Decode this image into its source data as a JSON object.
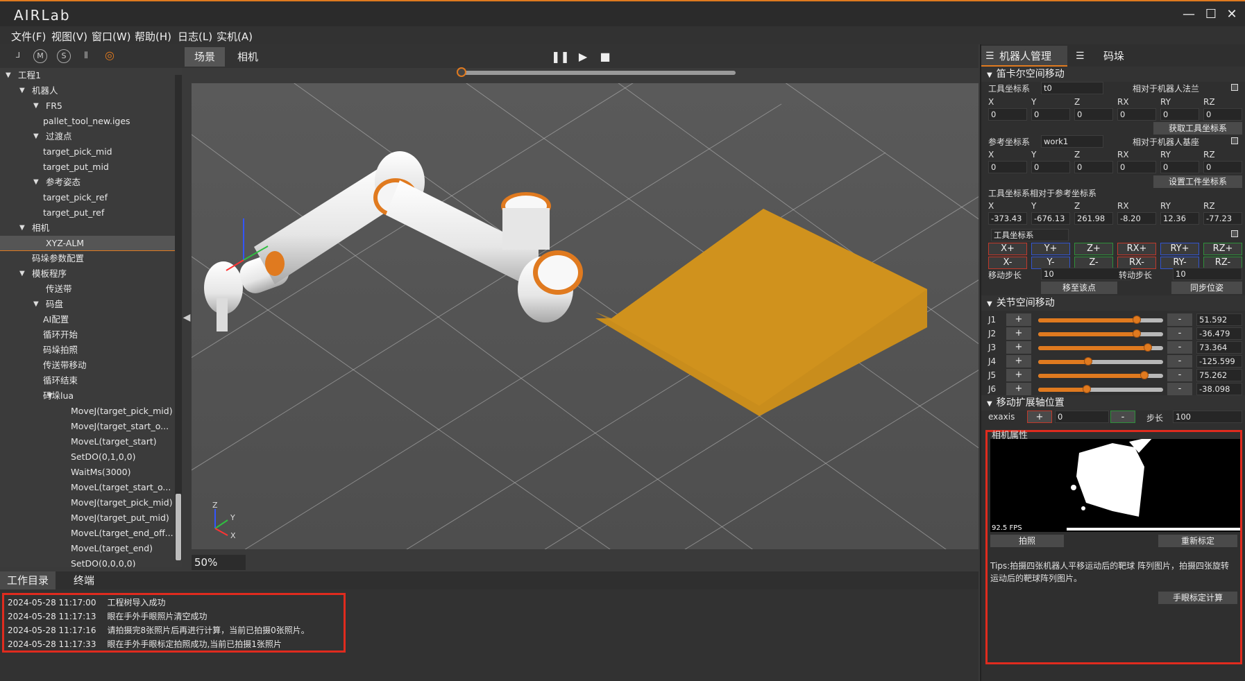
{
  "app": {
    "logo": "AIRLab"
  },
  "window_controls": {
    "minimize": "—",
    "maximize": "☐",
    "close": "✕"
  },
  "menu": [
    "文件(F)",
    "视图(V)",
    "窗口(W)",
    "帮助(H)",
    "日志(L)",
    "实机(A)"
  ],
  "toolbar_icons": [
    "axis-icon",
    "m-icon",
    "s-icon",
    "gripper-icon",
    "target-icon"
  ],
  "toolbar_glyphs": [
    "⅃",
    "M",
    "S",
    "⫼",
    "◎"
  ],
  "viewport_tabs": [
    "场景",
    "相机"
  ],
  "playback": {
    "pause": "❚❚",
    "play": "▶",
    "stop": "■",
    "progress": 0.0
  },
  "tree": [
    {
      "label": "工程1",
      "level": 0,
      "arrow": true
    },
    {
      "label": "机器人",
      "level": 1,
      "arrow": true
    },
    {
      "label": "FR5",
      "level": 2,
      "arrow": true
    },
    {
      "label": "pallet_tool_new.iges",
      "level": 3,
      "arrow": false
    },
    {
      "label": "过渡点",
      "level": 2,
      "arrow": true
    },
    {
      "label": "target_pick_mid",
      "level": 3,
      "arrow": false
    },
    {
      "label": "target_put_mid",
      "level": 3,
      "arrow": false
    },
    {
      "label": "参考姿态",
      "level": 2,
      "arrow": true
    },
    {
      "label": "target_pick_ref",
      "level": 3,
      "arrow": false
    },
    {
      "label": "target_put_ref",
      "level": 3,
      "arrow": false
    },
    {
      "label": "相机",
      "level": 1,
      "arrow": true
    },
    {
      "label": "XYZ-ALM",
      "level": 2,
      "arrow": false,
      "selected": true
    },
    {
      "label": "码垛参数配置",
      "level": 1,
      "arrow": false
    },
    {
      "label": "模板程序",
      "level": 1,
      "arrow": true
    },
    {
      "label": "传送带",
      "level": 2,
      "arrow": false
    },
    {
      "label": "码盘",
      "level": 2,
      "arrow": true
    },
    {
      "label": "AI配置",
      "level": 3,
      "arrow": false
    },
    {
      "label": "循环开始",
      "level": 3,
      "arrow": false
    },
    {
      "label": "码垛拍照",
      "level": 3,
      "arrow": false
    },
    {
      "label": "传送带移动",
      "level": 3,
      "arrow": false
    },
    {
      "label": "循环结束",
      "level": 3,
      "arrow": false
    },
    {
      "label": "码垛lua",
      "level": 3,
      "arrow": true
    },
    {
      "label": "MoveJ(target_pick_mid)",
      "level": 4,
      "arrow": false
    },
    {
      "label": "MoveJ(target_start_o...",
      "level": 4,
      "arrow": false
    },
    {
      "label": "MoveL(target_start)",
      "level": 4,
      "arrow": false
    },
    {
      "label": "SetDO(0,1,0,0)",
      "level": 4,
      "arrow": false
    },
    {
      "label": "WaitMs(3000)",
      "level": 4,
      "arrow": false
    },
    {
      "label": "MoveL(target_start_o...",
      "level": 4,
      "arrow": false
    },
    {
      "label": "MoveJ(target_pick_mid)",
      "level": 4,
      "arrow": false
    },
    {
      "label": "MoveJ(target_put_mid)",
      "level": 4,
      "arrow": false
    },
    {
      "label": "MoveL(target_end_off...",
      "level": 4,
      "arrow": false
    },
    {
      "label": "MoveL(target_end)",
      "level": 4,
      "arrow": false
    },
    {
      "label": "SetDO(0,0,0,0)",
      "level": 4,
      "arrow": false
    }
  ],
  "viewport": {
    "zoom": "50%",
    "axis_labels": [
      "Z",
      "Y",
      "X"
    ]
  },
  "log_tabs": [
    "工作目录",
    "终端"
  ],
  "logs": [
    {
      "time": "2024-05-28 11:17:00",
      "msg": "工程树导入成功"
    },
    {
      "time": "2024-05-28 11:17:13",
      "msg": "眼在手外手眼照片清空成功"
    },
    {
      "time": "2024-05-28 11:17:16",
      "msg": "请拍摄完8张照片后再进行计算，当前已拍摄0张照片。"
    },
    {
      "time": "2024-05-28 11:17:33",
      "msg": "眼在手外手眼标定拍照成功,当前已拍摄1张照片"
    }
  ],
  "right": {
    "tabs": [
      "机器人管理",
      "码垛"
    ],
    "cartesian": {
      "title": "笛卡尔空间移动",
      "tool_label": "工具坐标系",
      "tool_value": "t0",
      "tool_rel": "相对于机器人法兰",
      "axes": [
        "X",
        "Y",
        "Z",
        "RX",
        "RY",
        "RZ"
      ],
      "tool_vals": [
        "0",
        "0",
        "0",
        "0",
        "0",
        "0"
      ],
      "get_tool_btn": "获取工具坐标系",
      "ref_label": "参考坐标系",
      "ref_value": "work1",
      "ref_rel": "相对于机器人基座",
      "ref_vals": [
        "0",
        "0",
        "0",
        "0",
        "0",
        "0"
      ],
      "set_work_btn": "设置工件坐标系",
      "rel_title": "工具坐标系相对于参考坐标系",
      "rel_vals": [
        "-373.43",
        "-676.13",
        "261.98",
        "-8.20",
        "12.36",
        "-77.23"
      ],
      "jog_frame": "工具坐标系",
      "jog_plus": [
        "X+",
        "Y+",
        "Z+",
        "RX+",
        "RY+",
        "RZ+"
      ],
      "jog_minus": [
        "X-",
        "Y-",
        "Z-",
        "RX-",
        "RY-",
        "RZ-"
      ],
      "move_step_label": "移动步长",
      "move_step": "10",
      "rot_step_label": "转动步长",
      "rot_step": "10",
      "move_to_btn": "移至该点",
      "sync_btn": "同步位姿"
    },
    "joints": {
      "title": "关节空间移动",
      "plus": "+",
      "minus": "-",
      "items": [
        {
          "name": "J1",
          "value": "51.592",
          "level": 0.79
        },
        {
          "name": "J2",
          "value": "-36.479",
          "level": 0.79
        },
        {
          "name": "J3",
          "value": "73.364",
          "level": 0.88
        },
        {
          "name": "J4",
          "value": "-125.599",
          "level": 0.4
        },
        {
          "name": "J5",
          "value": "75.262",
          "level": 0.85
        },
        {
          "name": "J6",
          "value": "-38.098",
          "level": 0.39
        }
      ]
    },
    "ext_axis": {
      "title": "移动扩展轴位置",
      "label": "exaxis",
      "plus": "+",
      "value": "0",
      "minus": "-",
      "step_label": "步长",
      "step": "100"
    },
    "camera": {
      "title": "相机属性",
      "fps": "92.5 FPS",
      "capture_btn": "拍照",
      "recal_btn": "重新标定",
      "tips": "Tips:拍摄四张机器人平移运动后的靶球 阵列图片，拍摄四张旋转运动后的靶球阵列图片。",
      "calc_btn": "手眼标定计算"
    }
  },
  "colors": {
    "accent": "#e07a1f",
    "highlight_box": "#e02b1e",
    "plate": "#c98d1c"
  }
}
